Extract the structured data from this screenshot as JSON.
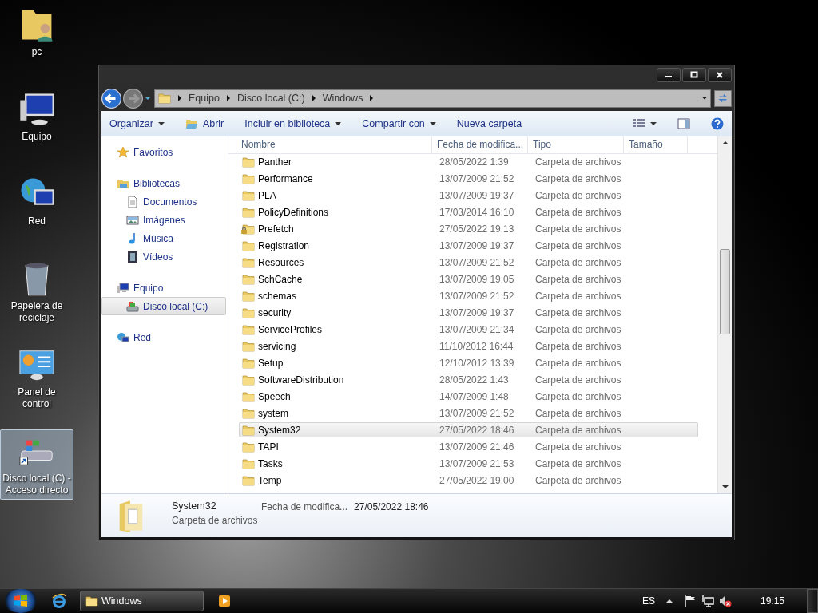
{
  "desktop_icons": [
    {
      "kind": "user-folder",
      "label": "pc",
      "selected": false
    },
    {
      "kind": "computer",
      "label": "Equipo",
      "selected": false
    },
    {
      "kind": "network",
      "label": "Red",
      "selected": false
    },
    {
      "kind": "recycle",
      "label": "Papelera de reciclaje",
      "selected": false
    },
    {
      "kind": "control-panel",
      "label": "Panel de control",
      "selected": false
    },
    {
      "kind": "drive-shortcut",
      "label": "Disco local (C) - Acceso directo",
      "selected": true
    }
  ],
  "window": {
    "breadcrumb": [
      "Equipo",
      "Disco local (C:)",
      "Windows"
    ],
    "toolbar": [
      {
        "label": "Organizar",
        "dropdown": true,
        "icon": false
      },
      {
        "label": "Abrir",
        "dropdown": false,
        "icon": true
      },
      {
        "label": "Incluir en biblioteca",
        "dropdown": true,
        "icon": false
      },
      {
        "label": "Compartir con",
        "dropdown": true,
        "icon": false
      },
      {
        "label": "Nueva carpeta",
        "dropdown": false,
        "icon": false
      }
    ],
    "sidebar": [
      {
        "kind": "star",
        "label": "Favoritos",
        "selected": false
      },
      {
        "kind": "library",
        "label": "Bibliotecas",
        "selected": false,
        "children": [
          {
            "kind": "document",
            "label": "Documentos",
            "selected": false
          },
          {
            "kind": "picture",
            "label": "Imágenes",
            "selected": false
          },
          {
            "kind": "music",
            "label": "Música",
            "selected": false
          },
          {
            "kind": "video",
            "label": "Vídeos",
            "selected": false
          }
        ]
      },
      {
        "kind": "computer",
        "label": "Equipo",
        "selected": false,
        "children": [
          {
            "kind": "drive",
            "label": "Disco local (C:)",
            "selected": true
          }
        ]
      },
      {
        "kind": "network",
        "label": "Red",
        "selected": false
      }
    ],
    "columns": [
      "Nombre",
      "Fecha de modifica...",
      "Tipo",
      "Tamaño"
    ],
    "rows": [
      {
        "name": "Panther",
        "date": "28/05/2022 1:39",
        "type": "Carpeta de archivos",
        "locked": false,
        "selected": false
      },
      {
        "name": "Performance",
        "date": "13/07/2009 21:52",
        "type": "Carpeta de archivos",
        "locked": false,
        "selected": false
      },
      {
        "name": "PLA",
        "date": "13/07/2009 19:37",
        "type": "Carpeta de archivos",
        "locked": false,
        "selected": false
      },
      {
        "name": "PolicyDefinitions",
        "date": "17/03/2014 16:10",
        "type": "Carpeta de archivos",
        "locked": false,
        "selected": false
      },
      {
        "name": "Prefetch",
        "date": "27/05/2022 19:13",
        "type": "Carpeta de archivos",
        "locked": true,
        "selected": false
      },
      {
        "name": "Registration",
        "date": "13/07/2009 19:37",
        "type": "Carpeta de archivos",
        "locked": false,
        "selected": false
      },
      {
        "name": "Resources",
        "date": "13/07/2009 21:52",
        "type": "Carpeta de archivos",
        "locked": false,
        "selected": false
      },
      {
        "name": "SchCache",
        "date": "13/07/2009 19:05",
        "type": "Carpeta de archivos",
        "locked": false,
        "selected": false
      },
      {
        "name": "schemas",
        "date": "13/07/2009 21:52",
        "type": "Carpeta de archivos",
        "locked": false,
        "selected": false
      },
      {
        "name": "security",
        "date": "13/07/2009 19:37",
        "type": "Carpeta de archivos",
        "locked": false,
        "selected": false
      },
      {
        "name": "ServiceProfiles",
        "date": "13/07/2009 21:34",
        "type": "Carpeta de archivos",
        "locked": false,
        "selected": false
      },
      {
        "name": "servicing",
        "date": "11/10/2012 16:44",
        "type": "Carpeta de archivos",
        "locked": false,
        "selected": false
      },
      {
        "name": "Setup",
        "date": "12/10/2012 13:39",
        "type": "Carpeta de archivos",
        "locked": false,
        "selected": false
      },
      {
        "name": "SoftwareDistribution",
        "date": "28/05/2022 1:43",
        "type": "Carpeta de archivos",
        "locked": false,
        "selected": false
      },
      {
        "name": "Speech",
        "date": "14/07/2009 1:48",
        "type": "Carpeta de archivos",
        "locked": false,
        "selected": false
      },
      {
        "name": "system",
        "date": "13/07/2009 21:52",
        "type": "Carpeta de archivos",
        "locked": false,
        "selected": false
      },
      {
        "name": "System32",
        "date": "27/05/2022 18:46",
        "type": "Carpeta de archivos",
        "locked": false,
        "selected": true
      },
      {
        "name": "TAPI",
        "date": "13/07/2009 21:46",
        "type": "Carpeta de archivos",
        "locked": false,
        "selected": false
      },
      {
        "name": "Tasks",
        "date": "13/07/2009 21:53",
        "type": "Carpeta de archivos",
        "locked": false,
        "selected": false
      },
      {
        "name": "Temp",
        "date": "27/05/2022 19:00",
        "type": "Carpeta de archivos",
        "locked": false,
        "selected": false
      }
    ],
    "details": {
      "name": "System32",
      "type": "Carpeta de archivos",
      "date_label": "Fecha de modifica...",
      "date": "27/05/2022 18:46"
    }
  },
  "taskbar": {
    "tasks": [
      {
        "kind": "explorer",
        "label": "Windows",
        "selected": true
      }
    ],
    "language": "ES",
    "clock": "19:15"
  }
}
